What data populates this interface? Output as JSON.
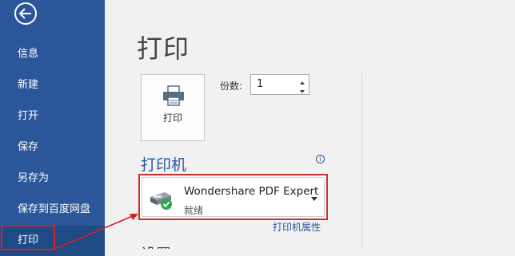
{
  "sidebar": {
    "items": [
      {
        "label": "信息"
      },
      {
        "label": "新建"
      },
      {
        "label": "打开"
      },
      {
        "label": "保存"
      },
      {
        "label": "另存为"
      },
      {
        "label": "保存到百度网盘"
      },
      {
        "label": "打印"
      }
    ],
    "active_index": 6
  },
  "main": {
    "title": "打印",
    "print_button_label": "打印",
    "copies_label": "份数:",
    "copies_value": "1",
    "printer_section_title": "打印机",
    "info_icon_glyph": "i",
    "printer": {
      "name": "Wondershare PDF Expert",
      "status": "就绪"
    },
    "printer_properties_link": "打印机属性",
    "settings_section_title": "设置"
  },
  "colors": {
    "sidebar_bg": "#2b579a",
    "highlight_red": "#d42027",
    "accent_blue": "#2b579a"
  },
  "icons": {
    "back": "back-arrow-icon",
    "printer": "printer-icon",
    "printer_status": "printer-ready-icon"
  }
}
